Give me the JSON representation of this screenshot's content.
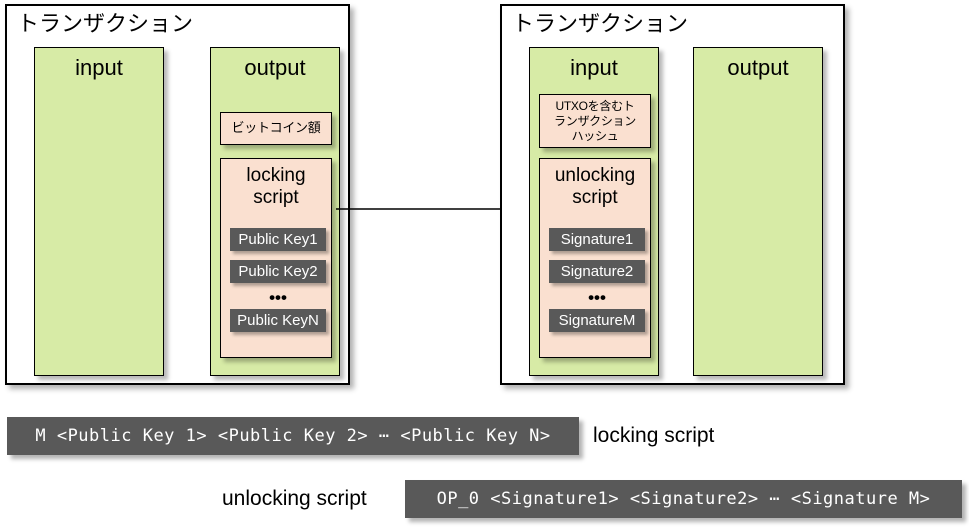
{
  "diagram": {
    "title_left": "トランザクション",
    "title_right": "トランザクション",
    "colors": {
      "green": "#d7eba6",
      "pink": "#fae0d0",
      "chip": "#595959",
      "frame": "#000000",
      "background": "#ffffff"
    }
  },
  "left_tx": {
    "title": "トランザクション",
    "input": {
      "label": "input"
    },
    "output": {
      "label": "output",
      "amount_box": "ビットコイン額",
      "script": {
        "title_line1": "locking",
        "title_line2": "script",
        "items": [
          "Public Key1",
          "Public Key2",
          "Public KeyN"
        ],
        "ellipsis": "•••"
      }
    }
  },
  "right_tx": {
    "title": "トランザクション",
    "input": {
      "label": "input",
      "hash_box": "UTXOを含むトランザクションハッシュ",
      "hash_box_lines": [
        "UTXOを含むト",
        "ランザクション",
        "ハッシュ"
      ],
      "script": {
        "title_line1": "unlocking",
        "title_line2": "script",
        "items": [
          "Signature1",
          "Signature2",
          "SignatureM"
        ],
        "ellipsis": "•••"
      }
    },
    "output": {
      "label": "output"
    }
  },
  "arrow": {
    "name": "utxo-spend-arrow"
  },
  "bottom": {
    "locking": {
      "code": "M <Public Key 1> <Public Key 2> ⋯ <Public Key N>",
      "label": "locking script"
    },
    "unlocking": {
      "code": "OP_0 <Signature1> <Signature2> ⋯ <Signature M>",
      "label": "unlocking script"
    }
  }
}
